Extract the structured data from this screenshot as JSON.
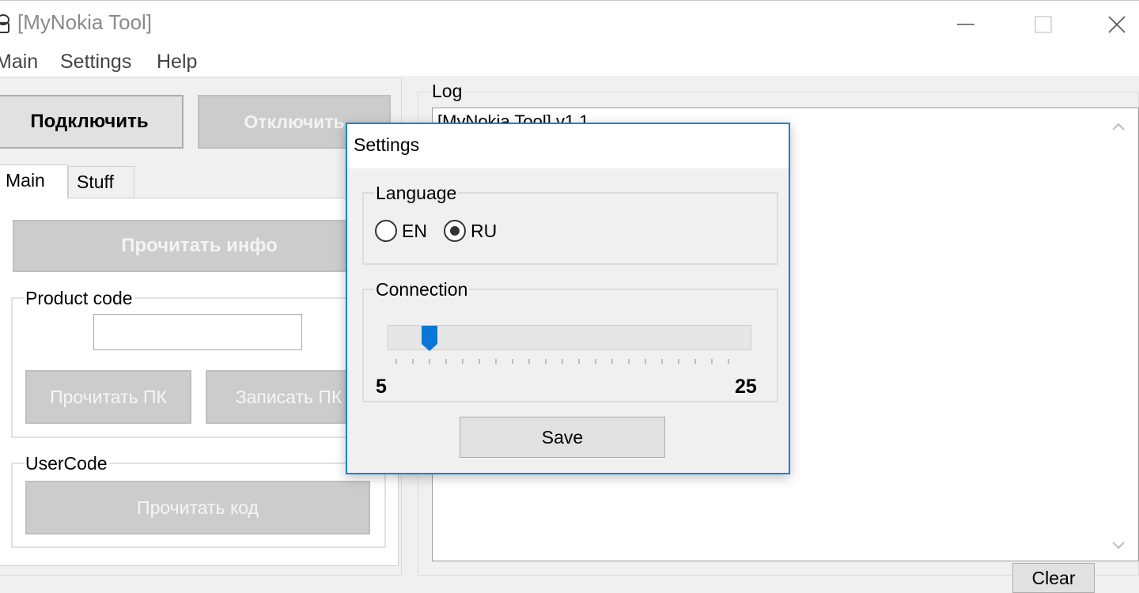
{
  "window": {
    "title": "[MyNokia Tool]",
    "icon": "android-icon",
    "controls": [
      "minimize-icon",
      "maximize-icon",
      "close-icon"
    ]
  },
  "menu": {
    "items": [
      "Main",
      "Settings",
      "Help"
    ]
  },
  "toolbar": {
    "connect_label": "Подключить",
    "disconnect_label": "Отключить"
  },
  "tabs": [
    "Main",
    "Stuff"
  ],
  "main_tab": {
    "read_info_label": "Прочитать инфо",
    "product_code": {
      "label": "Product code",
      "value": "",
      "read_label": "Прочитать ПК",
      "write_label": "Записать ПК"
    },
    "user_code": {
      "label": "UserCode",
      "read_label": "Прочитать код"
    }
  },
  "log": {
    "label": "Log",
    "text": "[MyNokia Tool] v1.1",
    "clear_label": "Clear"
  },
  "settings_dialog": {
    "title": "Settings",
    "language": {
      "label": "Language",
      "options": [
        "EN",
        "RU"
      ],
      "selected": "RU"
    },
    "connection": {
      "label": "Connection",
      "min": "5",
      "max": "25",
      "value": 7
    },
    "save_label": "Save"
  },
  "colors": {
    "dialog_border": "#1883d7",
    "slider_thumb": "#0a76d8",
    "disabled_button": "#cccccc"
  }
}
